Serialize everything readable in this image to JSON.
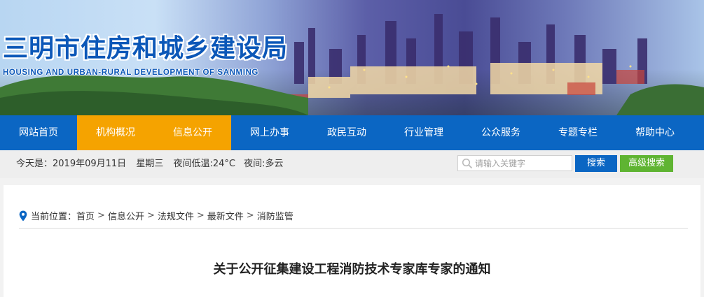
{
  "header": {
    "title": "三明市住房和城乡建设局",
    "subtitle": "HOUSING AND URBAN-RURAL DEVELOPMENT OF SANMING"
  },
  "nav": {
    "items": [
      {
        "label": "网站首页"
      },
      {
        "label": "机构概况"
      },
      {
        "label": "信息公开"
      },
      {
        "label": "网上办事"
      },
      {
        "label": "政民互动"
      },
      {
        "label": "行业管理"
      },
      {
        "label": "公众服务"
      },
      {
        "label": "专题专栏"
      },
      {
        "label": "帮助中心"
      }
    ],
    "active_color": "#f5a300",
    "bar_color": "#0b66c3"
  },
  "infobar": {
    "date": "今天是：2019年09月11日",
    "weekday": "星期三",
    "low_temp": "夜间低温:24°C",
    "weather": "夜间:多云"
  },
  "search": {
    "placeholder": "请输入关键字",
    "button": "搜索",
    "advanced_button": "高级搜索",
    "icon": "search-icon"
  },
  "breadcrumb": {
    "label": "当前位置：",
    "items": [
      "首页",
      "信息公开",
      "法规文件",
      "最新文件",
      "消防监管"
    ],
    "separator": ">",
    "icon": "location-pin-icon"
  },
  "article": {
    "title": "关于公开征集建设工程消防技术专家库专家的通知"
  }
}
